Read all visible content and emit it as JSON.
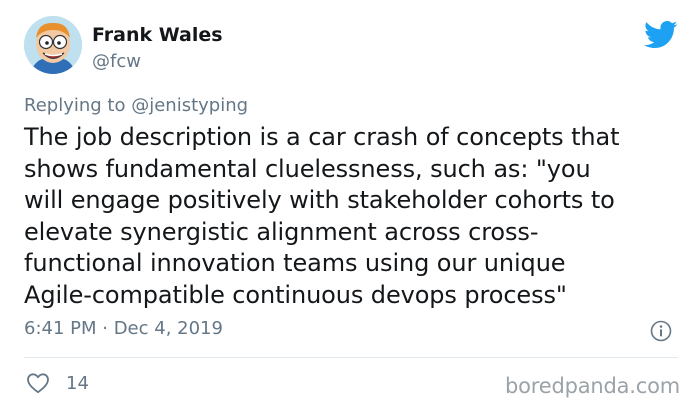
{
  "user": {
    "name": "Frank Wales",
    "handle": "@fcw"
  },
  "reply": {
    "prefix": "Replying to",
    "mention": "@jenistyping"
  },
  "tweet": {
    "lines": [
      "The job description is a car crash of concepts that",
      "shows fundamental cluelessness, such as: \"you",
      "will engage positively with stakeholder cohorts to",
      "elevate synergistic alignment across cross-",
      "functional innovation teams using our unique",
      "Agile-compatible continuous devops process\""
    ]
  },
  "meta": {
    "timestamp": "6:41 PM · Dec 4, 2019"
  },
  "actions": {
    "like_count": "14"
  },
  "watermark": "boredpanda.com",
  "icons": {
    "brand": "twitter-bird-icon",
    "info": "info-icon",
    "like": "heart-icon"
  },
  "colors": {
    "twitter_blue": "#1da1f2",
    "secondary_text": "#657786",
    "primary_text": "#14171a",
    "divider": "#e1e8ed"
  }
}
